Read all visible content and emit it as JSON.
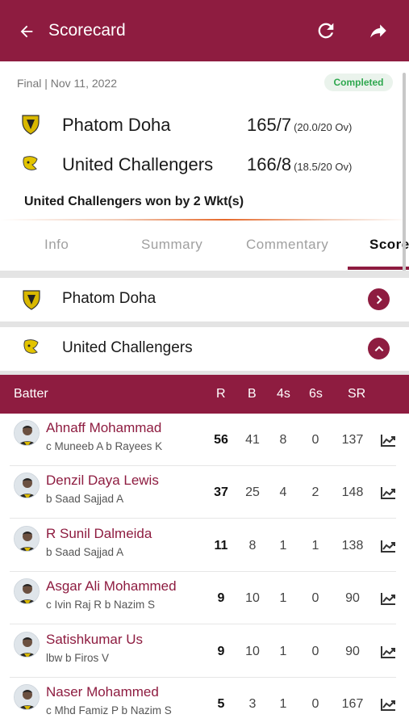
{
  "header": {
    "title": "Scorecard",
    "back_icon": "arrow-left-icon",
    "refresh_icon": "refresh-icon",
    "share_icon": "share-icon"
  },
  "match": {
    "meta": "Final | Nov 11, 2022",
    "status": "Completed",
    "teams": [
      {
        "name": "Phatom Doha",
        "score": "165/7",
        "overs": "(20.0/20 Ov)"
      },
      {
        "name": "United Challengers",
        "score": "166/8",
        "overs": "(18.5/20 Ov)"
      }
    ],
    "result": "United Challengers won by 2 Wkt(s)"
  },
  "tabs": [
    "Info",
    "Summary",
    "Commentary",
    "Score"
  ],
  "active_tab": "Score",
  "innings": [
    {
      "name": "Phatom Doha",
      "state": "collapsed",
      "icon": "chevron-right-icon"
    },
    {
      "name": "United Challengers",
      "state": "expanded",
      "icon": "chevron-up-icon"
    }
  ],
  "table": {
    "headers": {
      "batter": "Batter",
      "r": "R",
      "b": "B",
      "fours": "4s",
      "sixes": "6s",
      "sr": "SR"
    },
    "rows": [
      {
        "name": "Ahnaff Mohammad",
        "dismissal": "c Muneeb A b Rayees K",
        "r": "56",
        "b": "41",
        "fours": "8",
        "sixes": "0",
        "sr": "137"
      },
      {
        "name": "Denzil Daya Lewis",
        "dismissal": "b Saad Sajjad A",
        "r": "37",
        "b": "25",
        "fours": "4",
        "sixes": "2",
        "sr": "148"
      },
      {
        "name": "R Sunil Dalmeida",
        "dismissal": "b Saad Sajjad A",
        "r": "11",
        "b": "8",
        "fours": "1",
        "sixes": "1",
        "sr": "138"
      },
      {
        "name": "Asgar Ali Mohammed",
        "dismissal": "c Ivin Raj R b Nazim S",
        "r": "9",
        "b": "10",
        "fours": "1",
        "sixes": "0",
        "sr": "90"
      },
      {
        "name": "Satishkumar Us",
        "dismissal": "lbw b Firos V",
        "r": "9",
        "b": "10",
        "fours": "1",
        "sixes": "0",
        "sr": "90"
      },
      {
        "name": "Naser Mohammed",
        "dismissal": "c Mhd Famiz P b Nazim S",
        "r": "5",
        "b": "3",
        "fours": "1",
        "sixes": "0",
        "sr": "167"
      }
    ]
  },
  "colors": {
    "brand": "#8e1c40",
    "completed": "#2fa84f",
    "accent_line": "#e66a2c"
  }
}
